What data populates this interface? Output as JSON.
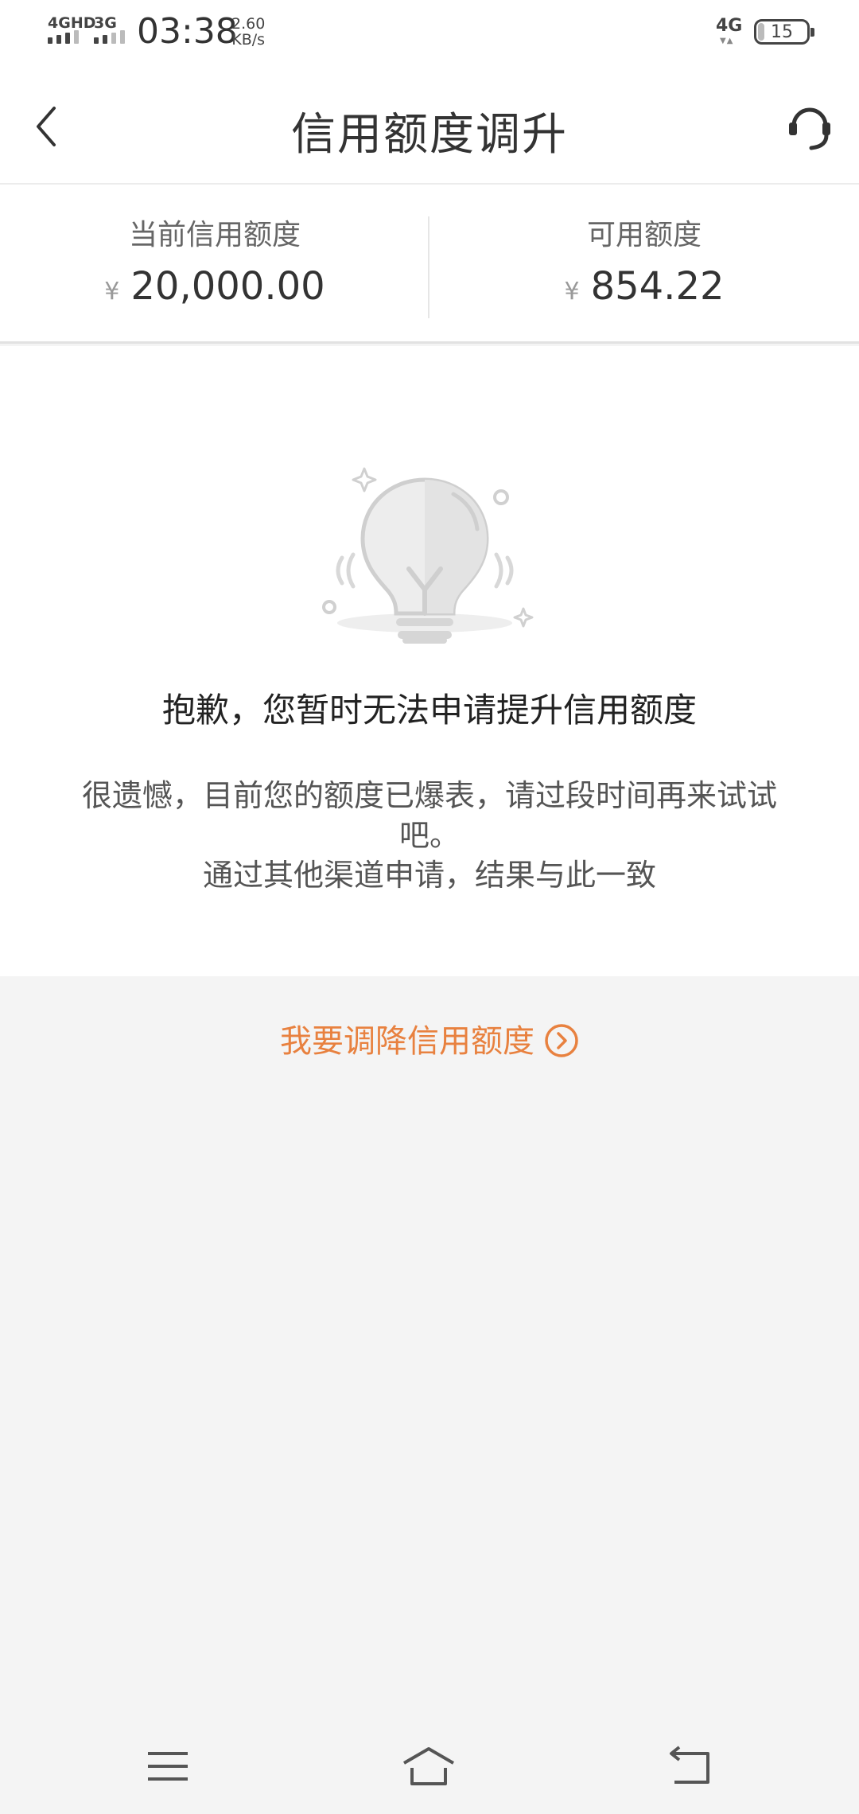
{
  "status_bar": {
    "network_left_1": "4GHD",
    "network_left_2": "3G",
    "time": "03:38",
    "speed_value": "2.60",
    "speed_unit": "KB/s",
    "network_right": "4G",
    "battery_level": "15"
  },
  "header": {
    "title": "信用额度调升",
    "back_icon": "chevron-left-icon",
    "service_icon": "headset-icon"
  },
  "credit": {
    "current_label": "当前信用额度",
    "current_currency": "¥",
    "current_value": "20,000.00",
    "available_label": "可用额度",
    "available_currency": "¥",
    "available_value": "854.22"
  },
  "message": {
    "title": "抱歉，您暂时无法申请提升信用额度",
    "line1": "很遗憾，目前您的额度已爆表，请过段时间再来试试吧。",
    "line2": "通过其他渠道申请，结果与此一致"
  },
  "actions": {
    "lower_limit_label": "我要调降信用额度"
  },
  "colors": {
    "accent": "#e8813f",
    "background": "#f4f4f4",
    "card": "#ffffff"
  }
}
